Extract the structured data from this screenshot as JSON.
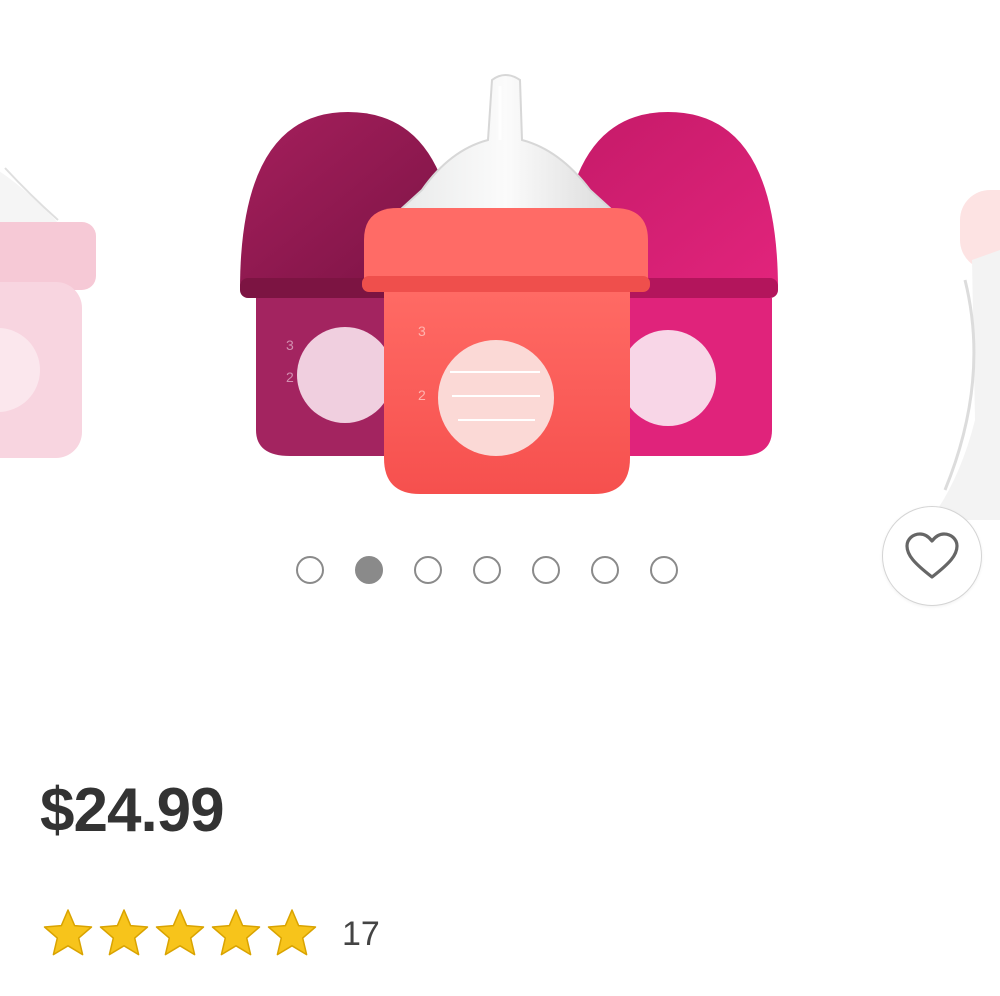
{
  "product": {
    "price": "$24.99",
    "review_count": "17"
  },
  "rating": {
    "value": 5,
    "max": 5
  },
  "carousel": {
    "slide_count": 7,
    "active_index": 1
  },
  "icons": {
    "favorite": "heart-outline-icon",
    "rating_star": "star-icon"
  },
  "colors": {
    "star": "#F7C41B",
    "star_outline": "#D9A300",
    "dot": "#8a8a8a",
    "price_text": "#333333",
    "bottle_dark": "#8E1A4E",
    "bottle_coral": "#F65A57",
    "bottle_magenta": "#D21C72"
  }
}
